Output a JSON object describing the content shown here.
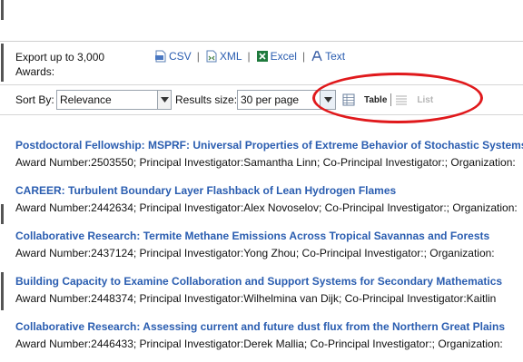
{
  "export": {
    "label": "Export up to 3,000 Awards:",
    "links": [
      {
        "label": "CSV",
        "icon": "csv-file-icon"
      },
      {
        "label": "XML",
        "icon": "xml-file-icon"
      },
      {
        "label": "Excel",
        "icon": "excel-file-icon"
      },
      {
        "label": "Text",
        "icon": "text-file-icon"
      }
    ],
    "separator": "|"
  },
  "toolbar": {
    "sort_label": "Sort By:",
    "sort_value": "Relevance",
    "results_label": "Results size:",
    "results_value": "30 per page",
    "view_table": "Table",
    "view_list": "List"
  },
  "results": [
    {
      "title": "Postdoctoral Fellowship: MSPRF: Universal Properties of Extreme Behavior of Stochastic Systems",
      "meta": "Award Number:2503550; Principal Investigator:Samantha Linn; Co-Principal Investigator:; Organization:"
    },
    {
      "title": "CAREER: Turbulent Boundary Layer Flashback of Lean Hydrogen Flames",
      "meta": "Award Number:2442634; Principal Investigator:Alex Novoselov; Co-Principal Investigator:; Organization:"
    },
    {
      "title": "Collaborative Research: Termite Methane Emissions Across Tropical Savannas and Forests",
      "meta": "Award Number:2437124; Principal Investigator:Yong Zhou; Co-Principal Investigator:; Organization:"
    },
    {
      "title": "Building Capacity to Examine Collaboration and Support Systems for Secondary Mathematics",
      "meta": "Award Number:2448374; Principal Investigator:Wilhelmina van Dijk; Co-Principal Investigator:Kaitlin"
    },
    {
      "title": "Collaborative Research: Assessing current and future dust flux from the Northern Great Plains",
      "meta": "Award Number:2446433; Principal Investigator:Derek Mallia; Co-Principal Investigator:; Organization:"
    }
  ],
  "colors": {
    "link": "#2a5db0",
    "highlight_circle": "#e0191c"
  }
}
